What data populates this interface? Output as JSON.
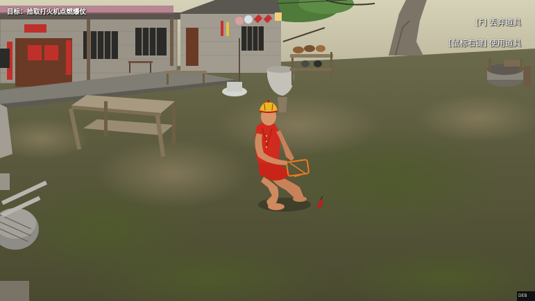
{
  "hud": {
    "objective": "目标：拾取打火机点燃爆仗",
    "hint_drop": "[F] 丢弃道具",
    "hint_use": "[鼠标右键] 使用道具"
  },
  "debug_tag": "DEB",
  "colors": {
    "ground": "#5b5a3e",
    "sky": "#c9c4a8",
    "character_outfit": "#d12a1e",
    "hat": "#e8b820",
    "lighter_outline": "#f07a1e"
  }
}
